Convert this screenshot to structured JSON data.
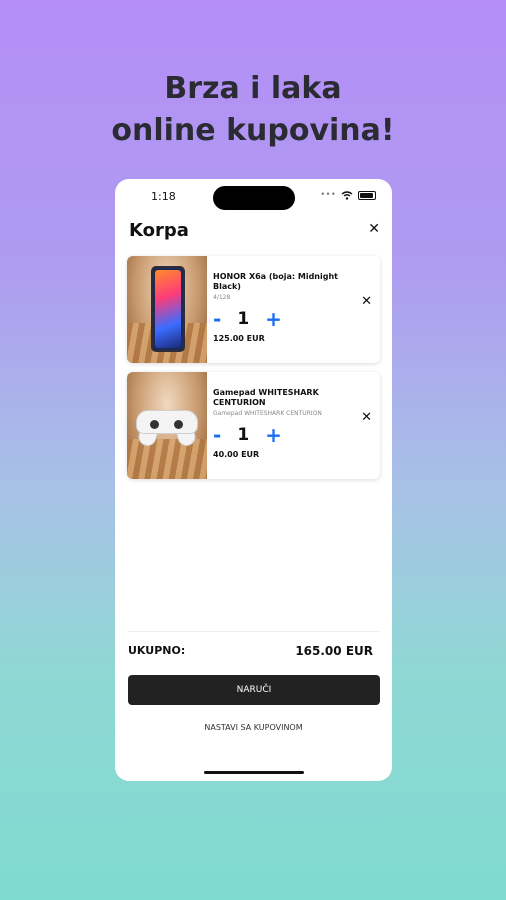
{
  "promo": {
    "headline_line1": "Brza i laka",
    "headline_line2": "online kupovina!"
  },
  "status_bar": {
    "time": "1:18"
  },
  "cart": {
    "title": "Korpa",
    "close_icon": "close-icon",
    "items": [
      {
        "name": "HONOR X6a (boja: Midnight Black)",
        "subtitle": "4/128",
        "quantity": "1",
        "minus": "-",
        "plus": "+",
        "price": "125.00 EUR",
        "remove_icon": "close-icon"
      },
      {
        "name": "Gamepad WHITESHARK CENTURION",
        "subtitle": "Gamepad WHITESHARK CENTURION",
        "quantity": "1",
        "minus": "-",
        "plus": "+",
        "price": "40.00 EUR",
        "remove_icon": "close-icon"
      }
    ],
    "total_label": "UKUPNO:",
    "total_value": "165.00 EUR",
    "order_button": "NARUČI",
    "continue_link": "NASTAVI SA KUPOVINOM"
  },
  "colors": {
    "accent": "#1b6ef3",
    "button_bg": "#222222"
  }
}
